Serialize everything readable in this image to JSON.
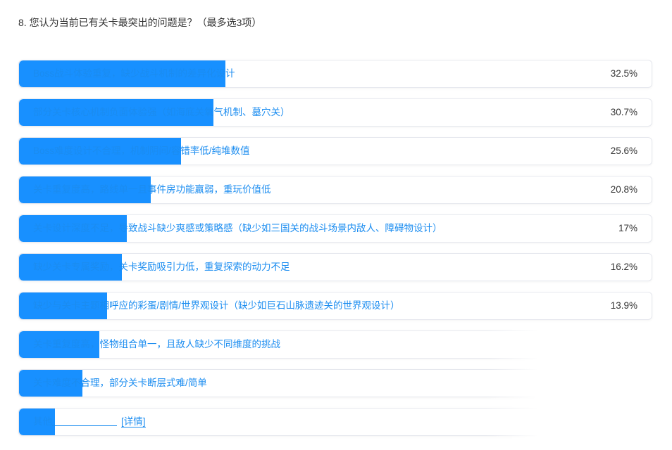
{
  "question": {
    "title": "8. 您认为当前已有关卡最突出的问题是？（最多选3项）"
  },
  "options": [
    {
      "label": "Boss战斗体验重复，缺少战斗机制的差异化设计",
      "percent_text": "32.5%",
      "fill_fraction": 0.325
    },
    {
      "label": "部分关卡核心机制负面体验强（如海底关氧气机制、墓穴关）",
      "percent_text": "30.7%",
      "fill_fraction": 0.307
    },
    {
      "label": "Boss难度设计不合理，机制阴间/容错率低/纯堆数值",
      "percent_text": "25.6%",
      "fill_fraction": 0.256
    },
    {
      "label": "关卡重复度高，路线单一且事件房功能羸弱，重玩价值低",
      "percent_text": "20.8%",
      "fill_fraction": 0.208
    },
    {
      "label": "关卡设计深度不足，导致战斗缺少爽感或策略感（缺少如三国关的战斗场景内敌人、障碍物设计）",
      "percent_text": "17%",
      "fill_fraction": 0.17
    },
    {
      "label": "缺少关卡专属奖励，关卡奖励吸引力低，重复探索的动力不足",
      "percent_text": "16.2%",
      "fill_fraction": 0.162
    },
    {
      "label": "缺少与关卡主题相呼应的彩蛋/剧情/世界观设计（缺少如巨石山脉遗迹关的世界观设计）",
      "percent_text": "13.9%",
      "fill_fraction": 0.139
    },
    {
      "label": "关卡重复度高，怪物组合单一，且敌人缺少不同维度的挑战",
      "percent_text": "",
      "fill_fraction": 0.127
    },
    {
      "label": "关卡难度不合理，部分关卡断层式难/简单",
      "percent_text": "",
      "fill_fraction": 0.1
    },
    {
      "label": "其他",
      "detail_label": "[详情]",
      "percent_text": "",
      "fill_fraction": 0.057
    }
  ],
  "colors": {
    "accent": "#1890ff",
    "text": "#333333",
    "option_text": "#1a8cf0"
  }
}
